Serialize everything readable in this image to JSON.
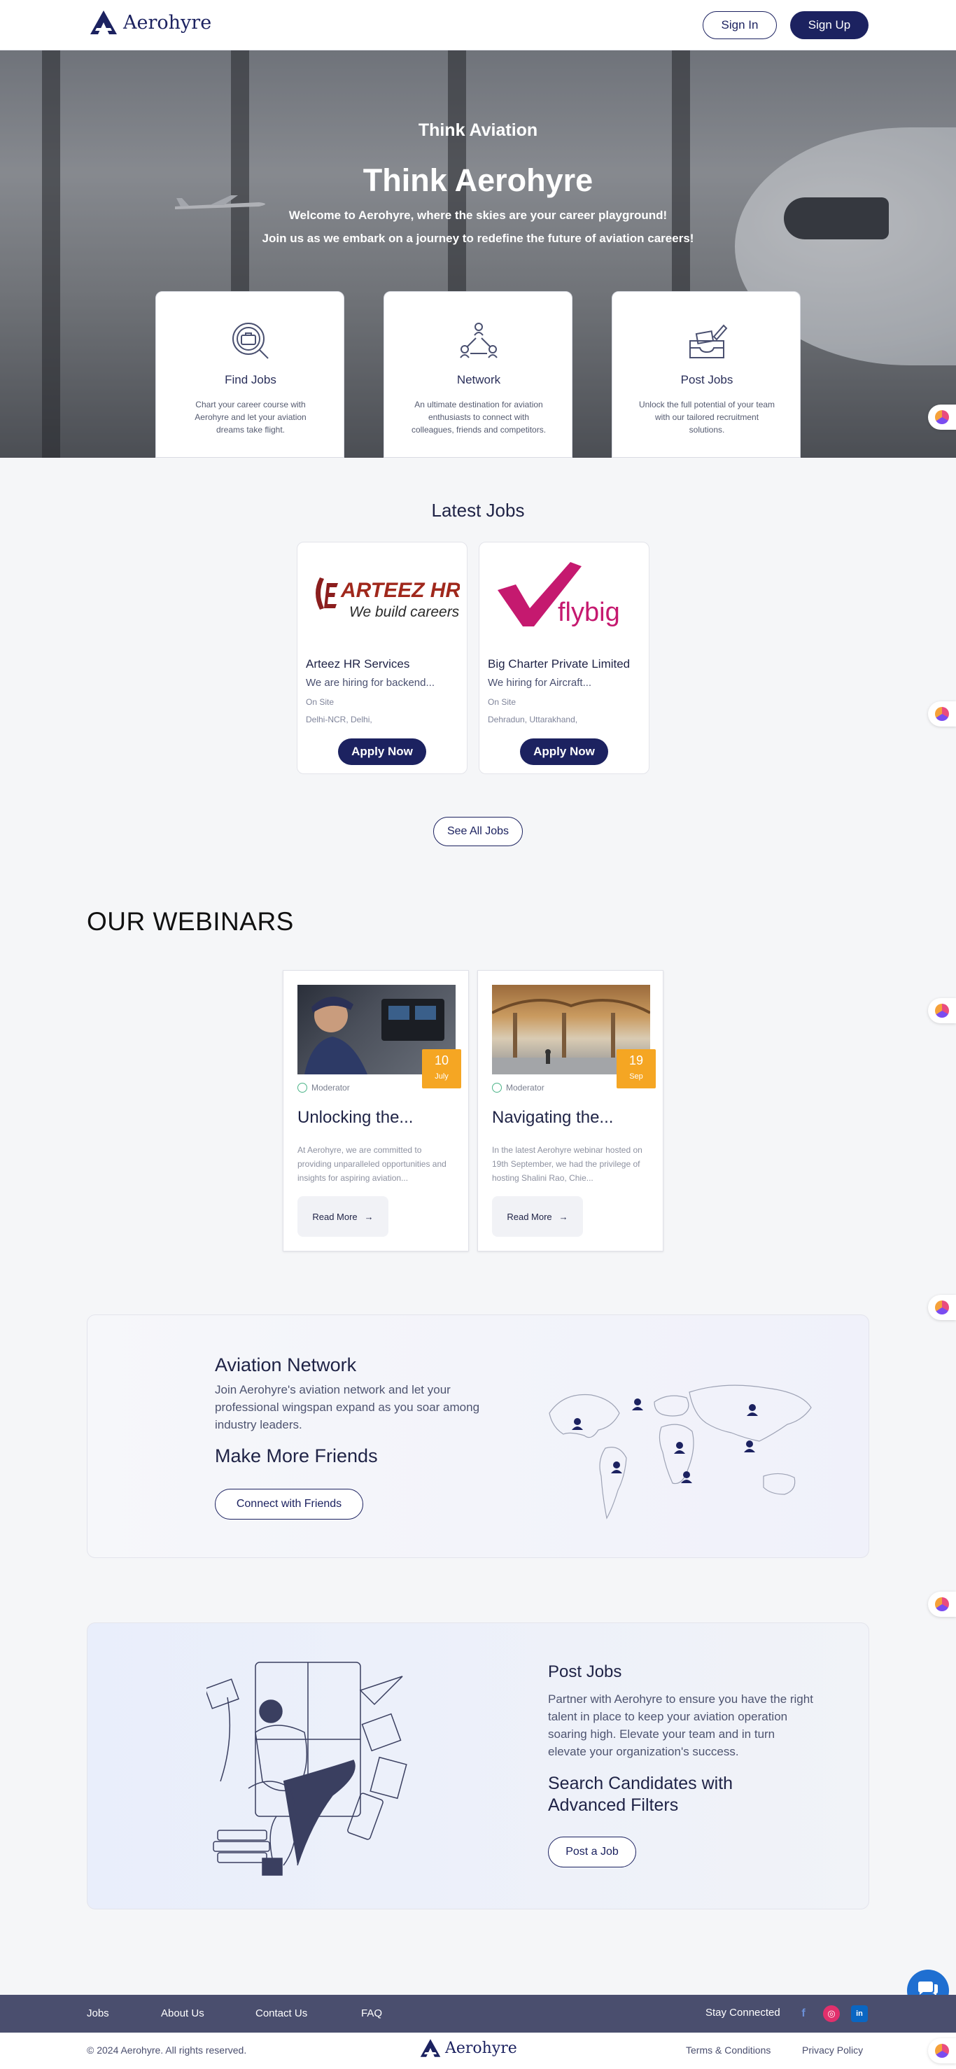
{
  "header": {
    "brand": "Aerohyre",
    "signin_label": "Sign In",
    "signup_label": "Sign Up"
  },
  "hero": {
    "subtitle": "Think Aviation",
    "title": "Think Aerohyre",
    "line1": "Welcome to Aerohyre, where the skies are your career playground!",
    "line2": "Join us as we embark on a journey to redefine the future of aviation careers!"
  },
  "features": [
    {
      "title": "Find Jobs",
      "desc": "Chart your career course with Aerohyre and let your aviation dreams take flight.",
      "icon": "briefcase-search-icon"
    },
    {
      "title": "Network",
      "desc": "An ultimate destination for aviation enthusiasts to connect with colleagues, friends and competitors.",
      "icon": "network-people-icon"
    },
    {
      "title": "Post Jobs",
      "desc": "Unlock the full potential of your team with our tailored recruitment solutions.",
      "icon": "post-tray-icon"
    }
  ],
  "latest_jobs": {
    "title": "Latest Jobs",
    "apply_label": "Apply Now",
    "see_all_label": "See All Jobs",
    "jobs": [
      {
        "company": "Arteez HR Services",
        "role": "We are hiring for backend...",
        "type": "On Site",
        "location": "Delhi-NCR, Delhi,",
        "logo_line1": "ARTEEZ HR",
        "logo_line2": "We build careers"
      },
      {
        "company": "Big Charter Private Limited",
        "role": "We hiring for Aircraft...",
        "type": "On Site",
        "location": "Dehradun, Uttarakhand,",
        "logo_text": "flybig"
      }
    ]
  },
  "webinars": {
    "title": "OUR WEBINARS",
    "moderator_label": "Moderator",
    "read_more_label": "Read More",
    "items": [
      {
        "day": "10",
        "month": "July",
        "title": "Unlocking the...",
        "desc": "At Aerohyre, we are committed to providing unparalleled opportunities and insights for aspiring aviation..."
      },
      {
        "day": "19",
        "month": "Sep",
        "title": "Navigating the...",
        "desc": "In the latest Aerohyre webinar hosted on 19th September, we had the privilege of hosting Shalini Rao, Chie..."
      }
    ]
  },
  "network": {
    "title": "Aviation Network",
    "desc": "Join Aerohyre's aviation network and let your professional wingspan expand as you soar among industry leaders.",
    "subtitle": "Make More Friends",
    "button_label": "Connect with Friends"
  },
  "post_jobs": {
    "title": "Post Jobs",
    "desc": "Partner with Aerohyre to ensure you have the right talent in place to keep your aviation operation soaring high. Elevate your team and in turn elevate your organization's success.",
    "subtitle": "Search Candidates with Advanced Filters",
    "button_label": "Post a Job"
  },
  "footer": {
    "links": [
      "Jobs",
      "About Us",
      "Contact Us",
      "FAQ"
    ],
    "stay_connected": "Stay Connected",
    "social": [
      {
        "icon": "facebook-icon",
        "glyph": "f",
        "color": "#3b5998"
      },
      {
        "icon": "instagram-icon",
        "glyph": "◎",
        "color": "#e1306c"
      },
      {
        "icon": "linkedin-icon",
        "glyph": "in",
        "color": "#0a66c2"
      }
    ],
    "copyright": "© 2024  Aerohyre. All rights reserved.",
    "terms": "Terms & Conditions",
    "privacy": "Privacy Policy"
  },
  "colors": {
    "primary": "#1c2260",
    "accent_orange": "#f5a623",
    "footer_bg": "#4a4e6e",
    "chat_blue": "#1f6fd1"
  }
}
